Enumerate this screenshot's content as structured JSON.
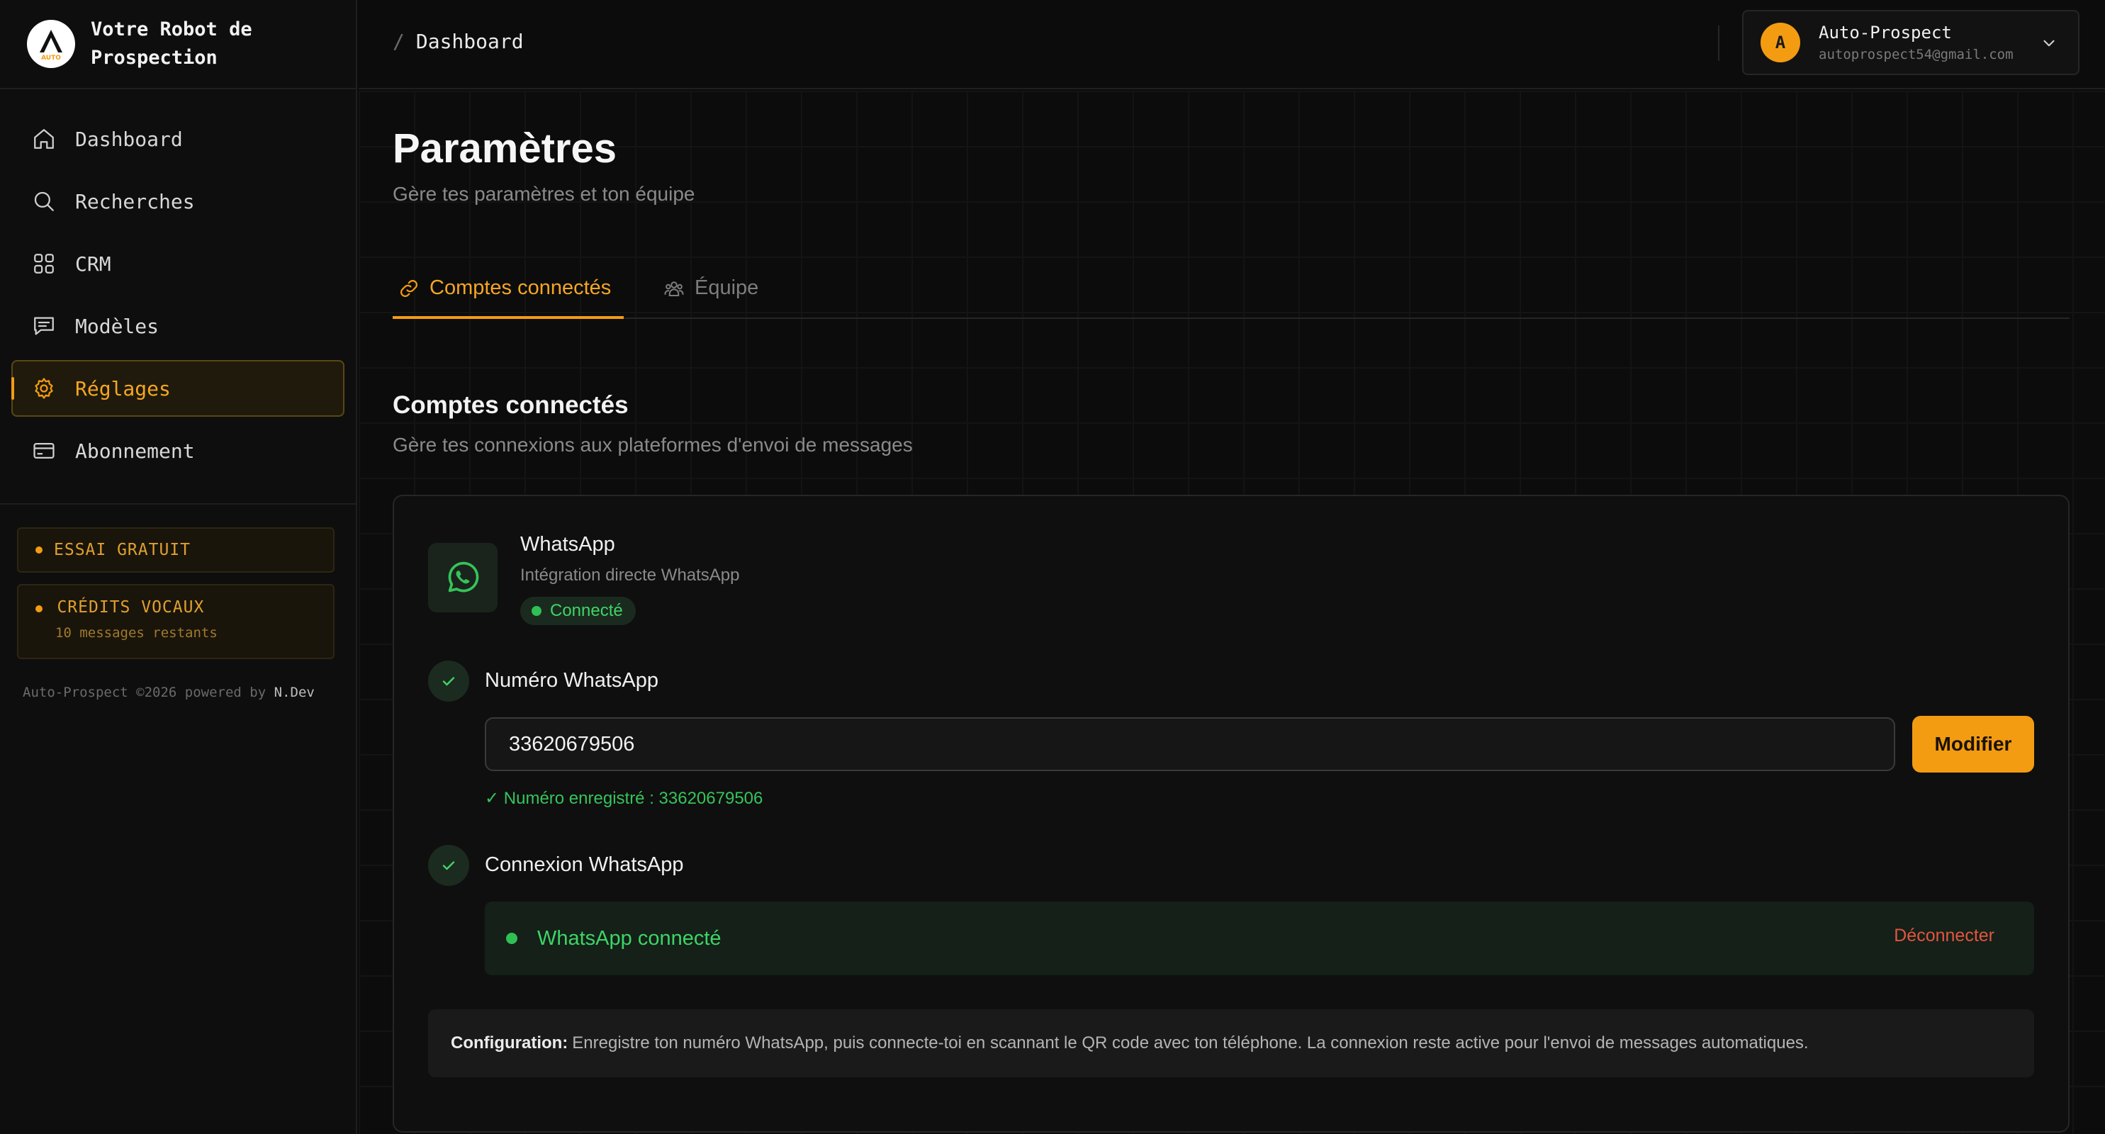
{
  "sidebar": {
    "brand_title": "Votre Robot de Prospection",
    "logo_text": "AUTO",
    "nav": [
      {
        "label": "Dashboard",
        "icon": "home-icon"
      },
      {
        "label": "Recherches",
        "icon": "search-icon"
      },
      {
        "label": "CRM",
        "icon": "grid-icon"
      },
      {
        "label": "Modèles",
        "icon": "message-icon"
      },
      {
        "label": "Réglages",
        "icon": "gear-icon",
        "active": true
      },
      {
        "label": "Abonnement",
        "icon": "credit-card-icon"
      }
    ],
    "trial_badge": "ESSAI GRATUIT",
    "credits_badge": "CRÉDITS VOCAUX",
    "credits_remaining": "10 messages restants",
    "footer_prefix": "Auto-Prospect ©2026 powered by",
    "footer_author": "N.Dev"
  },
  "topbar": {
    "breadcrumb_sep": "/",
    "breadcrumb": "Dashboard",
    "account": {
      "initial": "A",
      "name": "Auto-Prospect",
      "email": "autoprospect54@gmail.com"
    }
  },
  "page": {
    "title": "Paramètres",
    "subtitle": "Gère tes paramètres et ton équipe",
    "tabs": [
      {
        "label": "Comptes connectés",
        "icon": "link-icon",
        "active": true
      },
      {
        "label": "Équipe",
        "icon": "team-icon",
        "active": false
      }
    ],
    "section_title": "Comptes connectés",
    "section_subtitle": "Gère tes connexions aux plateformes d'envoi de messages"
  },
  "whatsapp": {
    "name": "WhatsApp",
    "description": "Intégration directe WhatsApp",
    "status": "Connecté",
    "step1_label": "Numéro WhatsApp",
    "phone_value": "33620679506",
    "modify_label": "Modifier",
    "saved_note": "✓ Numéro enregistré : 33620679506",
    "step2_label": "Connexion WhatsApp",
    "connected_text": "WhatsApp connecté",
    "disconnect_label": "Déconnecter",
    "config_label": "Configuration:",
    "config_text": "Enregistre ton numéro WhatsApp, puis connecte-toi en scannant le QR code avec ton téléphone. La connexion reste active pour l'envoi de messages automatiques."
  },
  "colors": {
    "accent": "#f39c12",
    "success": "#3ed466",
    "danger": "#e2553f",
    "background": "#0b0b0b"
  }
}
